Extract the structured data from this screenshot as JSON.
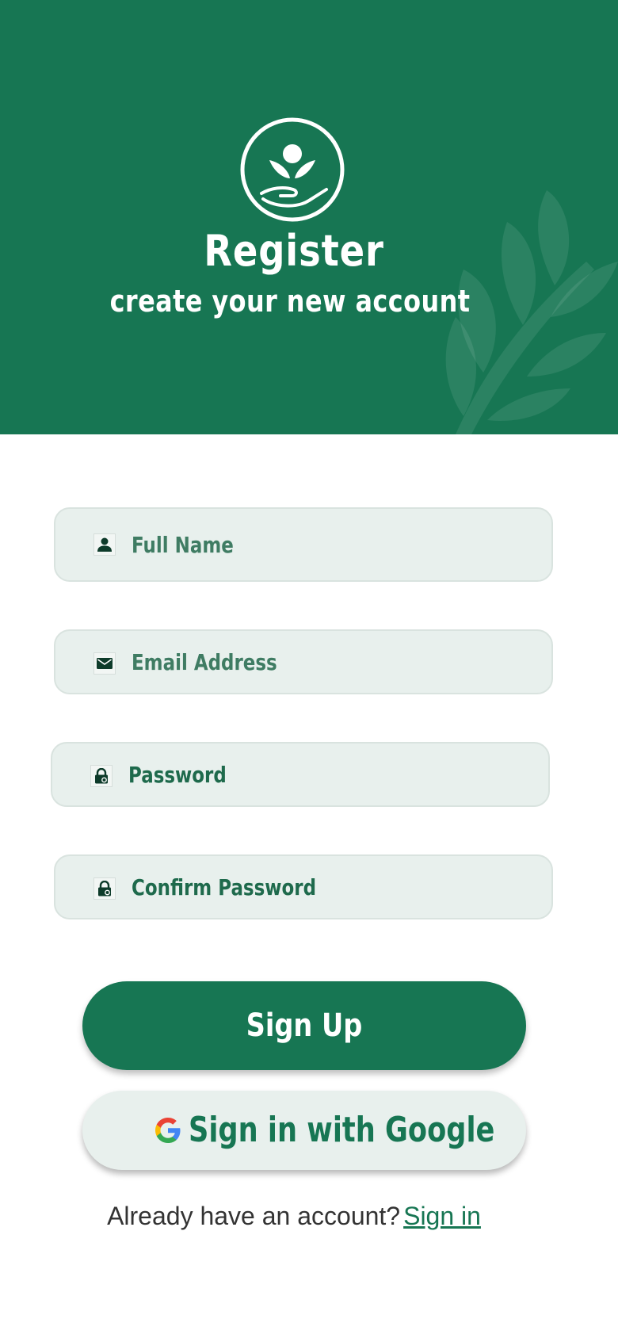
{
  "header": {
    "title": "Register",
    "subtitle": "create your new account",
    "logo_icon": "plant-in-hand-icon",
    "decoration_icon": "leaf-branch-icon"
  },
  "form": {
    "full_name": {
      "placeholder": "Full Name",
      "icon": "person-icon"
    },
    "email": {
      "placeholder": "Email Address",
      "icon": "mail-icon"
    },
    "password": {
      "placeholder": "Password",
      "icon": "lock-icon"
    },
    "confirm_password": {
      "placeholder": "Confirm Password",
      "icon": "lock-icon"
    }
  },
  "buttons": {
    "sign_up": "Sign Up",
    "google": "Sign in with Google",
    "google_icon": "google-g-icon"
  },
  "footer": {
    "question": "Already have an account?",
    "link": "Sign in"
  },
  "colors": {
    "primary": "#177653",
    "field_bg": "#e8f0ed",
    "text_dark": "#333333"
  }
}
